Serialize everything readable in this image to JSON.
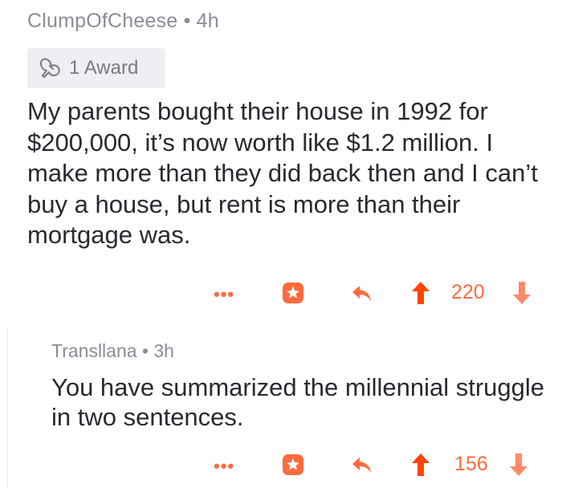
{
  "comment": {
    "author": "ClumpOfCheese",
    "separator": "•",
    "age": "4h",
    "award_label": "1 Award",
    "body": "My parents bought their house in 1992 for $200,000, it’s now worth like $1.2 million. I make more than they did back then and I can’t buy a house, but rent is more than their mortgage was.",
    "more": "•••",
    "score": "220",
    "accent": "#ff6b3d"
  },
  "reply": {
    "author": "Transllana",
    "separator": "•",
    "age": "3h",
    "body": "You have summarized the millennial struggle in two sentences.",
    "more": "•••",
    "score": "156"
  },
  "icons": [
    "award-icon",
    "more-icon",
    "award-give-icon",
    "reply-icon",
    "upvote-icon",
    "downvote-icon"
  ]
}
